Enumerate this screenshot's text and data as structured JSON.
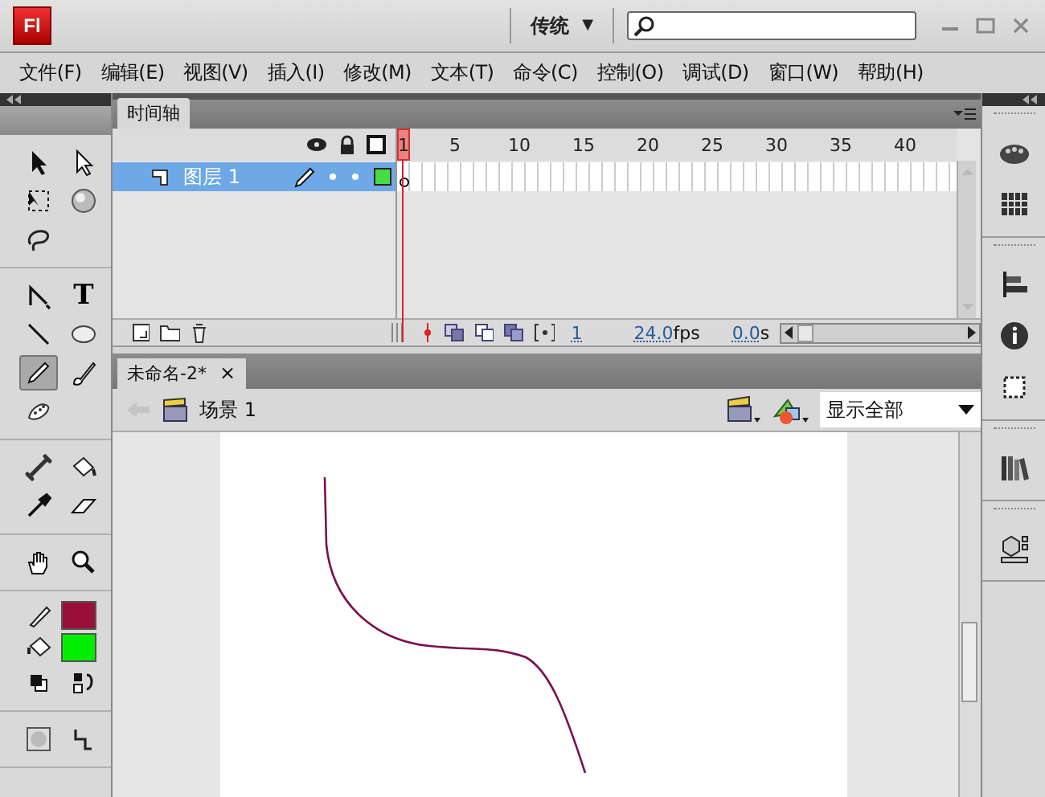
{
  "title_bar": {
    "logo": "Fl",
    "workspace": "传统",
    "workspace_caret": "▼"
  },
  "menu": [
    "文件(F)",
    "编辑(E)",
    "视图(V)",
    "插入(I)",
    "修改(M)",
    "文本(T)",
    "命令(C)",
    "控制(O)",
    "调试(D)",
    "窗口(W)",
    "帮助(H)"
  ],
  "timeline": {
    "tab": "时间轴",
    "frame_numbers": [
      "1",
      "5",
      "10",
      "15",
      "20",
      "25",
      "30",
      "35",
      "40"
    ],
    "layers": [
      {
        "name": "图层 1",
        "selected": true
      }
    ],
    "current_frame": "1",
    "frame_rate": "24.0",
    "frame_rate_unit": "fps",
    "elapsed": "0.0",
    "elapsed_unit": "s"
  },
  "document": {
    "tab": "未命名-2*",
    "close": "×",
    "scene": "场景 1",
    "zoom": "显示全部"
  },
  "tool_groups": [
    {
      "tools": [
        {
          "kind": "selection",
          "selected": false
        },
        {
          "kind": "subselection",
          "selected": false
        },
        {
          "kind": "free-transform",
          "selected": false
        },
        {
          "kind": "rotation-3d",
          "selected": false
        },
        {
          "kind": "lasso",
          "selected": false
        }
      ]
    },
    {
      "tools": [
        {
          "kind": "pen",
          "selected": false
        },
        {
          "kind": "text",
          "glyph": "T",
          "selected": false
        },
        {
          "kind": "line",
          "selected": false
        },
        {
          "kind": "oval",
          "selected": false
        },
        {
          "kind": "pencil",
          "selected": true
        },
        {
          "kind": "brush",
          "selected": false
        },
        {
          "kind": "deco",
          "selected": false
        }
      ]
    },
    {
      "tools": [
        {
          "kind": "bone",
          "selected": false
        },
        {
          "kind": "bucket",
          "selected": false
        },
        {
          "kind": "eyedropper",
          "selected": false
        },
        {
          "kind": "eraser",
          "selected": false
        }
      ]
    },
    {
      "tools": [
        {
          "kind": "hand",
          "selected": false
        },
        {
          "kind": "zoom",
          "selected": false
        }
      ]
    },
    {
      "tools": [
        {
          "kind": "stroke-color",
          "color": "#9a0f3a",
          "selected": false
        },
        {
          "kind": "fill-color",
          "color": "#00ee00",
          "selected": false
        },
        {
          "kind": "default-colors",
          "selected": false
        },
        {
          "kind": "swap-colors",
          "selected": false
        }
      ]
    },
    {
      "tools": [
        {
          "kind": "object-drawing",
          "selected": false
        },
        {
          "kind": "snap",
          "selected": false
        }
      ]
    }
  ],
  "panel_groups": [
    {
      "panels": [
        {
          "kind": "color"
        },
        {
          "kind": "swatches"
        }
      ]
    },
    {
      "panels": [
        {
          "kind": "align"
        },
        {
          "kind": "info"
        },
        {
          "kind": "transform"
        }
      ]
    },
    {
      "panels": [
        {
          "kind": "library"
        }
      ]
    },
    {
      "panels": [
        {
          "kind": "components"
        }
      ]
    }
  ]
}
